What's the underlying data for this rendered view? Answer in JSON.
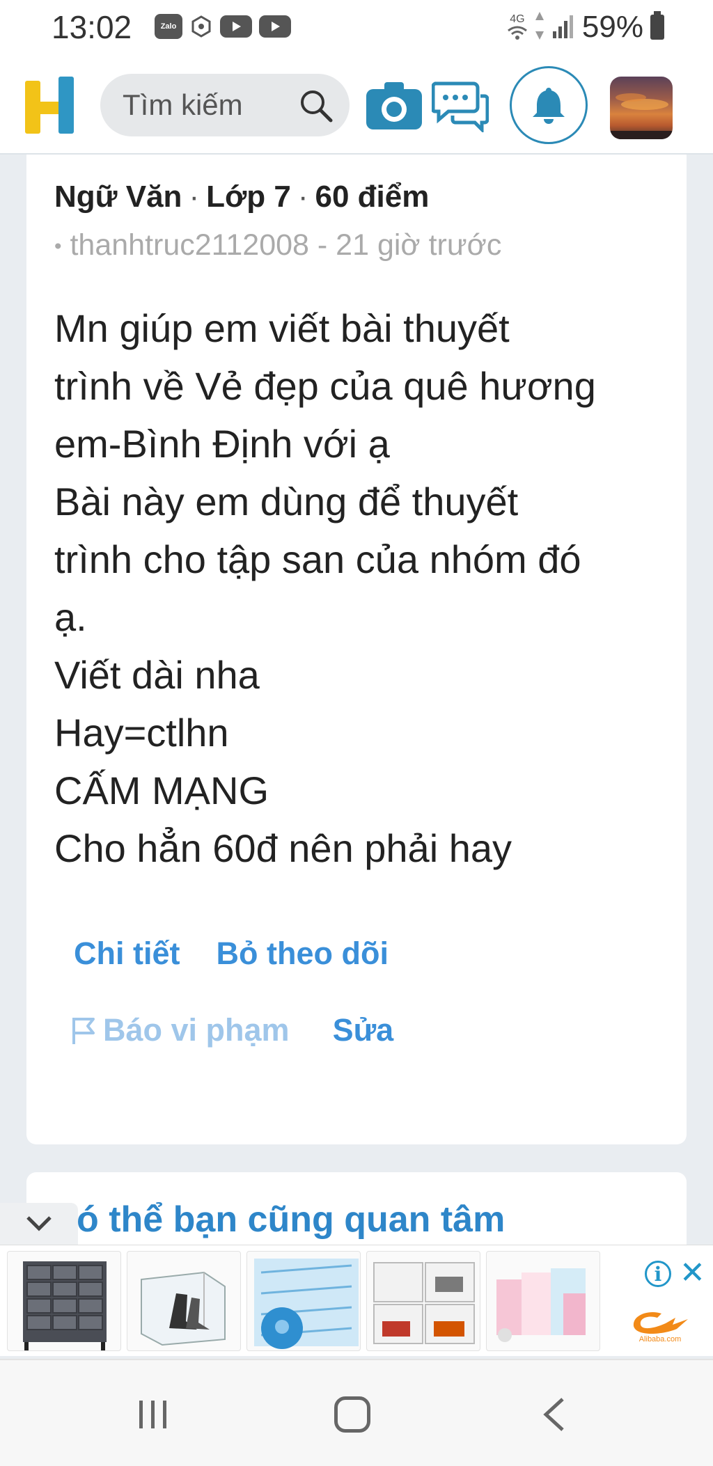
{
  "status_bar": {
    "time": "13:02",
    "zalo_label": "Zalo",
    "network": "4G",
    "battery": "59%"
  },
  "header": {
    "search_placeholder": "Tìm kiếm",
    "brand_color": "#2b8ab6",
    "logo_yellow": "#f2c318",
    "logo_blue": "#2f96c4"
  },
  "question": {
    "subject": "Ngữ Văn",
    "grade": "Lớp 7",
    "points": "60 điểm",
    "author_line": "thanhtruc2112008 - 21 giờ trước",
    "lines": [
      "Mn giúp em viết bài thuyết",
      "trình về Vẻ đẹp của quê hương",
      "em-Bình Định với ạ",
      "Bài này em dùng để thuyết",
      "trình cho tập san của nhóm đó",
      "ạ.",
      "Viết dài nha",
      "Hay=ctlhn",
      "CẤM MẠNG",
      "Cho hẳn 60đ nên phải hay"
    ],
    "actions": {
      "detail": "Chi tiết",
      "unfollow": "Bỏ theo dõi",
      "report": "Báo vi phạm",
      "edit": "Sửa"
    }
  },
  "related": {
    "title": "ó thể bạn cũng quan tâm"
  },
  "ad": {
    "info_label": "i",
    "close_label": "✕",
    "brand": "Alibaba.com"
  }
}
